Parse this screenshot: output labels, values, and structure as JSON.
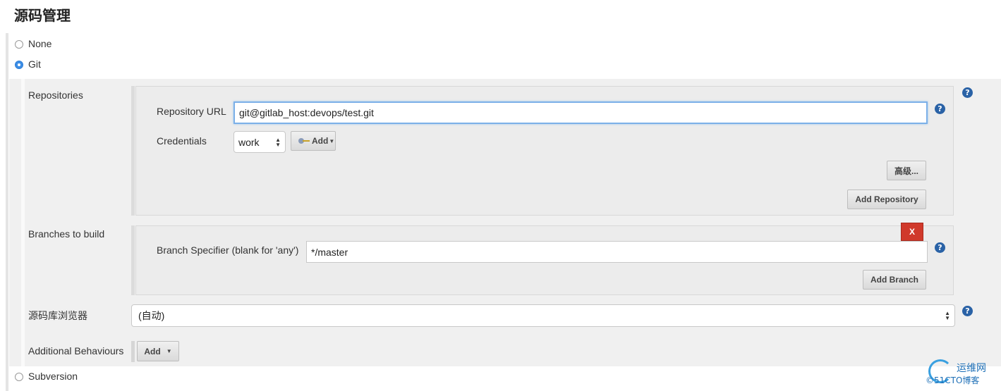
{
  "page": {
    "title": "源码管理"
  },
  "scm_options": {
    "none": {
      "label": "None",
      "selected": false
    },
    "git": {
      "label": "Git",
      "selected": true
    },
    "subversion": {
      "label": "Subversion",
      "selected": false
    }
  },
  "repositories": {
    "label": "Repositories",
    "url_label": "Repository URL",
    "url_value": "git@gitlab_host:devops/test.git",
    "credentials_label": "Credentials",
    "credentials_value": "work",
    "add_credentials_label": "Add",
    "advanced_label": "高级...",
    "add_repository_label": "Add Repository"
  },
  "branches": {
    "label": "Branches to build",
    "specifier_label": "Branch Specifier (blank for 'any')",
    "specifier_value": "*/master",
    "delete_label": "X",
    "add_branch_label": "Add Branch"
  },
  "browser": {
    "label": "源码库浏览器",
    "value": "(自动)"
  },
  "behaviours": {
    "label": "Additional Behaviours",
    "add_label": "Add"
  },
  "help": {
    "glyph": "?"
  },
  "watermark": {
    "line1": "运维网",
    "line2": "©51CTO博客"
  },
  "colors": {
    "accent": "#3d8ee6",
    "help": "#2a62a6",
    "delete": "#d0392b"
  }
}
